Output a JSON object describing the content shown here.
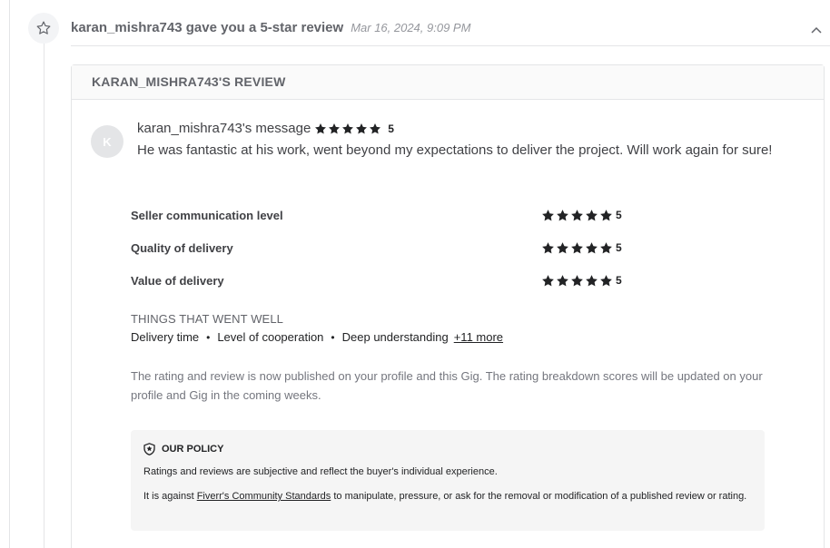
{
  "header": {
    "title": "karan_mishra743 gave you a 5-star review",
    "date": "Mar 16, 2024, 9:09 PM"
  },
  "card": {
    "title": "KARAN_MISHRA743'S REVIEW",
    "avatar_initial": "K",
    "message_title": "karan_mishra743's message",
    "overall_rating": 5,
    "overall_score": "5",
    "message": "He was fantastic at his work, went beyond my expectations to deliver the project. Will work again for sure!",
    "ratings": [
      {
        "label": "Seller communication level",
        "stars": 5,
        "score": "5"
      },
      {
        "label": "Quality of delivery",
        "stars": 5,
        "score": "5"
      },
      {
        "label": "Value of delivery",
        "stars": 5,
        "score": "5"
      }
    ],
    "went_well": {
      "title": "THINGS THAT WENT WELL",
      "items": [
        "Delivery time",
        "Level of cooperation",
        "Deep understanding"
      ],
      "more_label": "+11 more"
    },
    "publish_note": "The rating and review is now published on your profile and this Gig. The rating breakdown scores will be updated on your profile and Gig in the coming weeks.",
    "policy": {
      "title": "OUR POLICY",
      "line1": "Ratings and reviews are subjective and reflect the buyer's individual experience.",
      "line2_before": "It is against ",
      "line2_link": "Fiverr's Community Standards",
      "line2_after": " to manipulate, pressure, or ask for the removal or modification of a published review or rating."
    }
  },
  "icons": {
    "timeline": "star-outline-icon",
    "collapse": "chevron-up-icon",
    "rating": "star-filled-icon",
    "policy": "shield-star-icon"
  },
  "colors": {
    "star": "#222325",
    "text_primary": "#404145",
    "text_muted": "#74767e",
    "border": "#e4e5e7"
  }
}
